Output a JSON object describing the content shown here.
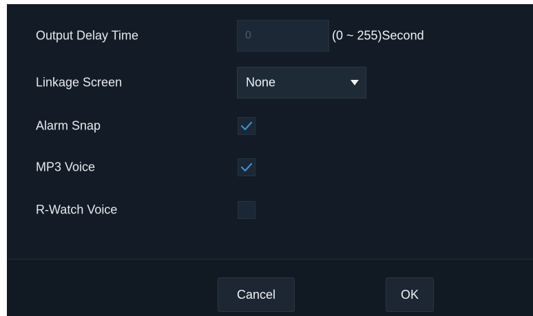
{
  "form": {
    "output_delay": {
      "label": "Output Delay Time",
      "value": "0",
      "unit": "(0 ~ 255)Second"
    },
    "linkage_screen": {
      "label": "Linkage Screen",
      "selected": "None"
    },
    "alarm_snap": {
      "label": "Alarm Snap",
      "checked": true
    },
    "mp3_voice": {
      "label": "MP3 Voice",
      "checked": true
    },
    "r_watch_voice": {
      "label": "R-Watch Voice",
      "checked": false
    }
  },
  "footer": {
    "cancel_label": "Cancel",
    "ok_label": "OK"
  },
  "colors": {
    "background": "#131c26",
    "checkmark": "#3f8fd0",
    "text": "#e6e9ee"
  }
}
